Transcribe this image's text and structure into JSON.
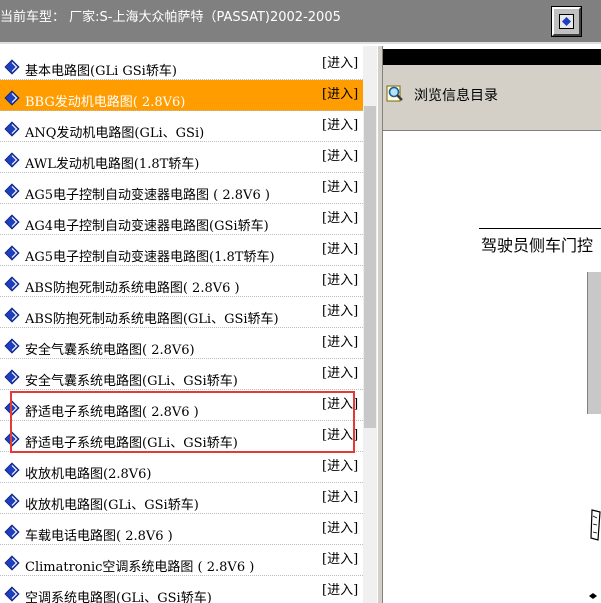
{
  "header": {
    "title": "当前车型： 厂家:S-上海大众帕萨特（PASSAT)2002-2005"
  },
  "list": {
    "enter_label": "[进入]",
    "items": [
      {
        "label": "基本电路图(GLi GSi轿车)"
      },
      {
        "label": "BBG发动机电路图( 2.8V6)",
        "selected": true
      },
      {
        "label": "ANQ发动机电路图(GLi、GSi)"
      },
      {
        "label": "AWL发动机电路图(1.8T轿车)"
      },
      {
        "label": "AG5电子控制自动变速器电路图 ( 2.8V6 )"
      },
      {
        "label": "AG4电子控制自动变速器电路图(GSi轿车)"
      },
      {
        "label": "AG5电子控制自动变速器电路图(1.8T轿车)"
      },
      {
        "label": "ABS防抱死制动系统电路图( 2.8V6 )"
      },
      {
        "label": "ABS防抱死制动系统电路图(GLi、GSi轿车)"
      },
      {
        "label": "安全气囊系统电路图( 2.8V6)"
      },
      {
        "label": "安全气囊系统电路图(GLi、GSi轿车)"
      },
      {
        "label": "舒适电子系统电路图( 2.8V6 )",
        "highlighted": true
      },
      {
        "label": "舒适电子系统电路图(GLi、GSi轿车)",
        "highlighted": true
      },
      {
        "label": "收放机电路图(2.8V6)"
      },
      {
        "label": "收放机电路图(GLi、GSi轿车)"
      },
      {
        "label": "车载电话电路图( 2.8V6 )"
      },
      {
        "label": "Climatronic空调系统电路图 ( 2.8V6 )"
      },
      {
        "label": "空调系统电路图(GLi、GSi轿车)"
      }
    ]
  },
  "right_panel": {
    "browse_label": "浏览信息目录",
    "doc_heading": "驾驶员侧车门控"
  },
  "colors": {
    "selected_row": "#ff9c00",
    "highlight_border": "#e53935",
    "icon_blue": "#1e3fbf"
  }
}
